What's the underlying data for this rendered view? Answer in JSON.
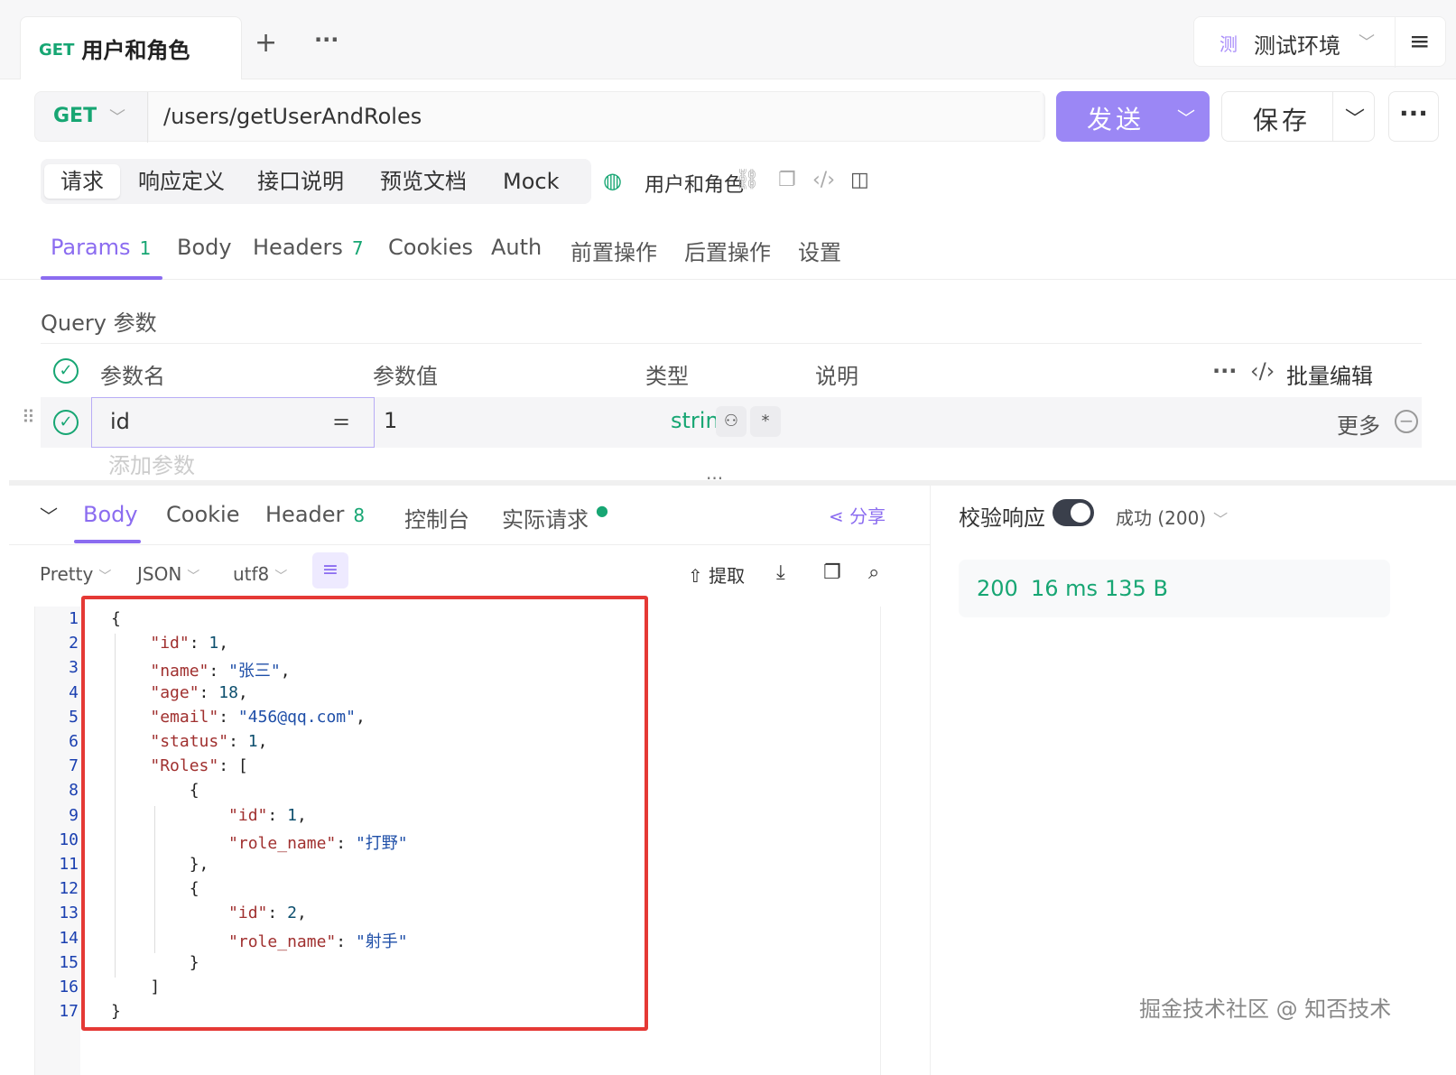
{
  "top_tab": {
    "method": "GET",
    "name": "用户和角色"
  },
  "top_actions": {
    "add": "+",
    "more": "···"
  },
  "environment": {
    "badge": "测",
    "name": "测试环境"
  },
  "request": {
    "method": "GET",
    "url": "/users/getUserAndRoles"
  },
  "buttons": {
    "send": "发送",
    "save": "保存",
    "more": "···"
  },
  "segments": [
    "请求",
    "响应定义",
    "接口说明",
    "预览文档",
    "Mock"
  ],
  "doc": {
    "name": "用户和角色"
  },
  "param_tabs": [
    {
      "label": "Params",
      "count": "1"
    },
    {
      "label": "Body",
      "count": ""
    },
    {
      "label": "Headers",
      "count": "7"
    },
    {
      "label": "Cookies",
      "count": ""
    },
    {
      "label": "Auth",
      "count": ""
    },
    {
      "label": "前置操作",
      "count": ""
    },
    {
      "label": "后置操作",
      "count": ""
    },
    {
      "label": "设置",
      "count": ""
    }
  ],
  "query": {
    "title": "Query 参数",
    "headers": {
      "name": "参数名",
      "value": "参数值",
      "type": "类型",
      "desc": "说明",
      "bulk_edit": "批量编辑"
    },
    "rows": [
      {
        "name": "id",
        "value": "1",
        "type": "string",
        "more": "更多"
      }
    ],
    "add_placeholder": "添加参数"
  },
  "response_tabs": [
    {
      "label": "Body",
      "count": ""
    },
    {
      "label": "Cookie",
      "count": ""
    },
    {
      "label": "Header",
      "count": "8"
    },
    {
      "label": "控制台",
      "count": ""
    },
    {
      "label": "实际请求",
      "count": ""
    }
  ],
  "share": "分享",
  "format": {
    "view": "Pretty",
    "lang": "JSON",
    "encoding": "utf8",
    "extract": "提取"
  },
  "code_lines": [
    "{",
    "    \"id\": 1,",
    "    \"name\": \"张三\",",
    "    \"age\": 18,",
    "    \"email\": \"456@qq.com\",",
    "    \"status\": 1,",
    "    \"Roles\": [",
    "        {",
    "            \"id\": 1,",
    "            \"role_name\": \"打野\"",
    "        },",
    "        {",
    "            \"id\": 2,",
    "            \"role_name\": \"射手\"",
    "        }",
    "    ]",
    "}"
  ],
  "validate": {
    "label": "校验响应",
    "enabled": true,
    "status_option": "成功 (200)"
  },
  "status": {
    "code": "200",
    "time": "16 ms",
    "size": "135 B"
  },
  "watermark": "掘金技术社区 @ 知否技术",
  "colors": {
    "accent": "#8b6cf0",
    "method_get": "#17a673",
    "send": "#9b87f5",
    "highlight": "#e53935"
  }
}
